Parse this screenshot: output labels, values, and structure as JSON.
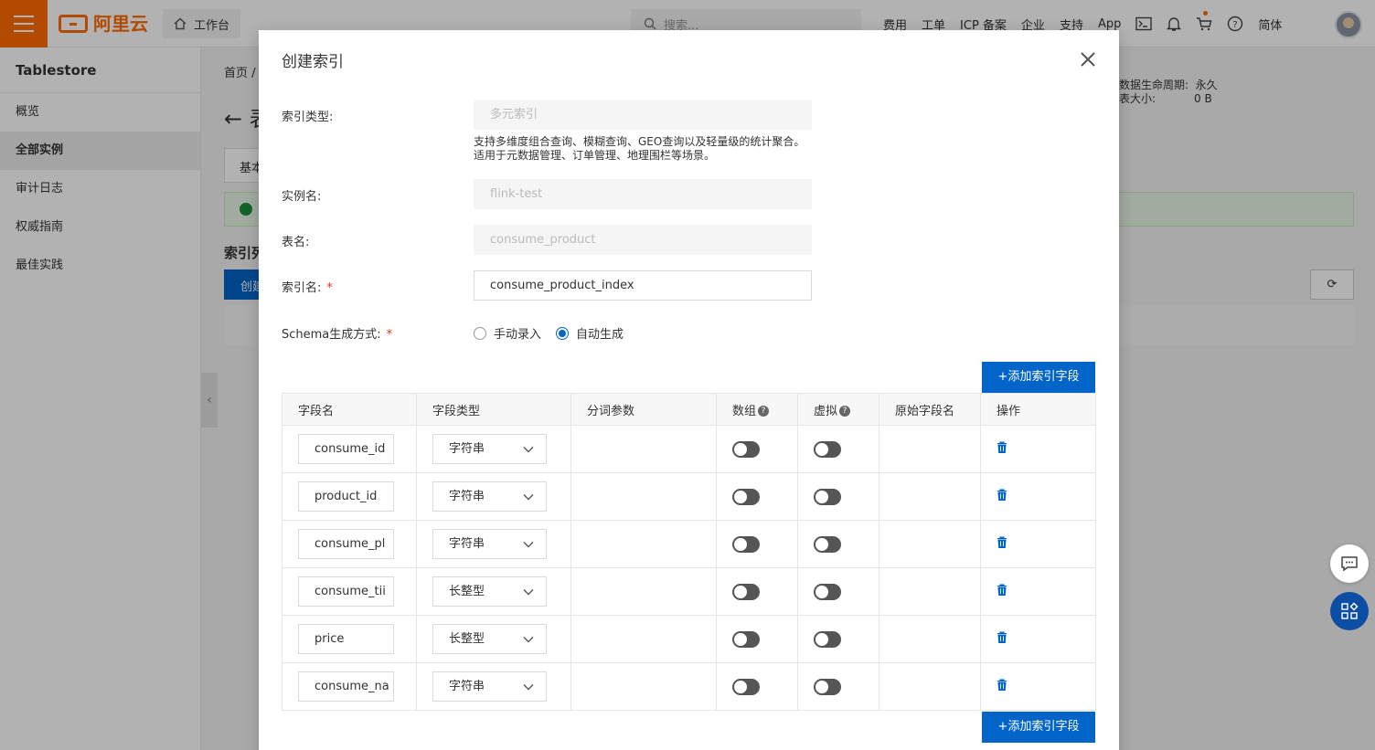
{
  "topbar": {
    "logo_text": "阿里云",
    "workbench_label": "工作台",
    "search_placeholder": "搜索...",
    "nav": [
      "费用",
      "工单",
      "ICP 备案",
      "企业",
      "支持",
      "App"
    ],
    "lang_label": "简体",
    "accent_color": "#ff6a00"
  },
  "sidebar": {
    "title": "Tablestore",
    "items": [
      {
        "label": "概览",
        "active": false
      },
      {
        "label": "全部实例",
        "active": true
      },
      {
        "label": "审计日志",
        "active": false
      },
      {
        "label": "权威指南",
        "active": false
      },
      {
        "label": "最佳实践",
        "active": false
      }
    ]
  },
  "background": {
    "breadcrumb": "首页 /",
    "title_partial": "← 表",
    "info_lines": [
      "数据生命周期:  永久",
      "表大小:           0 B"
    ],
    "tab_partial": "基本",
    "section_partial": "索引列",
    "create_partial": "创建"
  },
  "modal": {
    "title": "创建索引",
    "index_type": {
      "label": "索引类型:",
      "value": "多元索引",
      "description": "支持多维度组合查询、模糊查询、GEO查询以及轻量级的统计聚合。适用于元数据管理、订单管理、地理围栏等场景。"
    },
    "instance": {
      "label": "实例名:",
      "value": "flink-test"
    },
    "table": {
      "label": "表名:",
      "value": "consume_product"
    },
    "index_name": {
      "label": "索引名:",
      "value": "consume_product_index"
    },
    "schema_mode": {
      "label": "Schema生成方式:",
      "options": [
        "手动录入",
        "自动生成"
      ],
      "selected": "自动生成"
    },
    "add_field_label": "+添加索引字段",
    "columns": [
      "字段名",
      "字段类型",
      "分词参数",
      "数组",
      "虚拟",
      "原始字段名",
      "操作"
    ],
    "rows": [
      {
        "name": "consume_id",
        "type": "字符串",
        "array": false,
        "virtual": false
      },
      {
        "name": "product_id",
        "type": "字符串",
        "array": false,
        "virtual": false
      },
      {
        "name": "consume_pl",
        "type": "字符串",
        "array": false,
        "virtual": false
      },
      {
        "name": "consume_tii",
        "type": "长整型",
        "array": false,
        "virtual": false
      },
      {
        "name": "price",
        "type": "长整型",
        "array": false,
        "virtual": false
      },
      {
        "name": "consume_na",
        "type": "字符串",
        "array": false,
        "virtual": false
      }
    ],
    "primary_color": "#0064c8"
  }
}
